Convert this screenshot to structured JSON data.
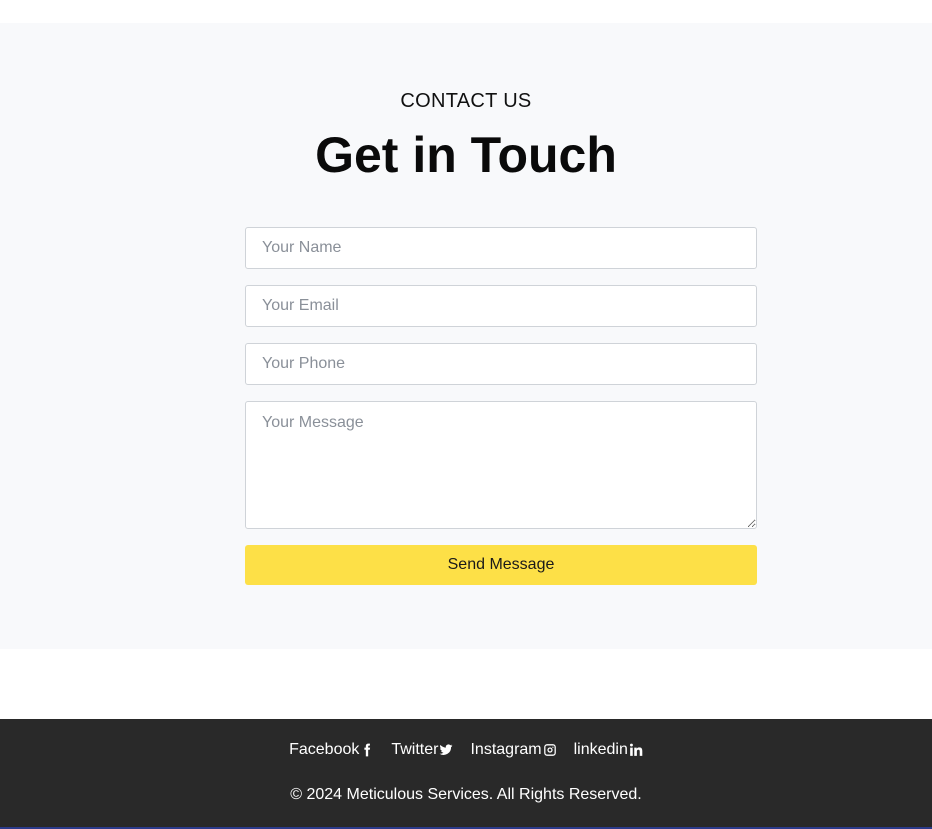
{
  "contact": {
    "eyebrow": "CONTACT US",
    "title": "Get in Touch",
    "name_placeholder": "Your Name",
    "email_placeholder": "Your Email",
    "phone_placeholder": "Your Phone",
    "message_placeholder": "Your Message",
    "submit_label": "Send Message",
    "accent_color": "#fde047"
  },
  "footer": {
    "links": [
      {
        "label": "Facebook",
        "icon": "facebook-icon"
      },
      {
        "label": "Twitter",
        "icon": "twitter-icon"
      },
      {
        "label": "Instagram",
        "icon": "instagram-icon"
      },
      {
        "label": "linkedin",
        "icon": "linkedin-icon"
      }
    ],
    "copyright": "© 2024 Meticulous Services. All Rights Reserved.",
    "background_color": "#292929"
  }
}
